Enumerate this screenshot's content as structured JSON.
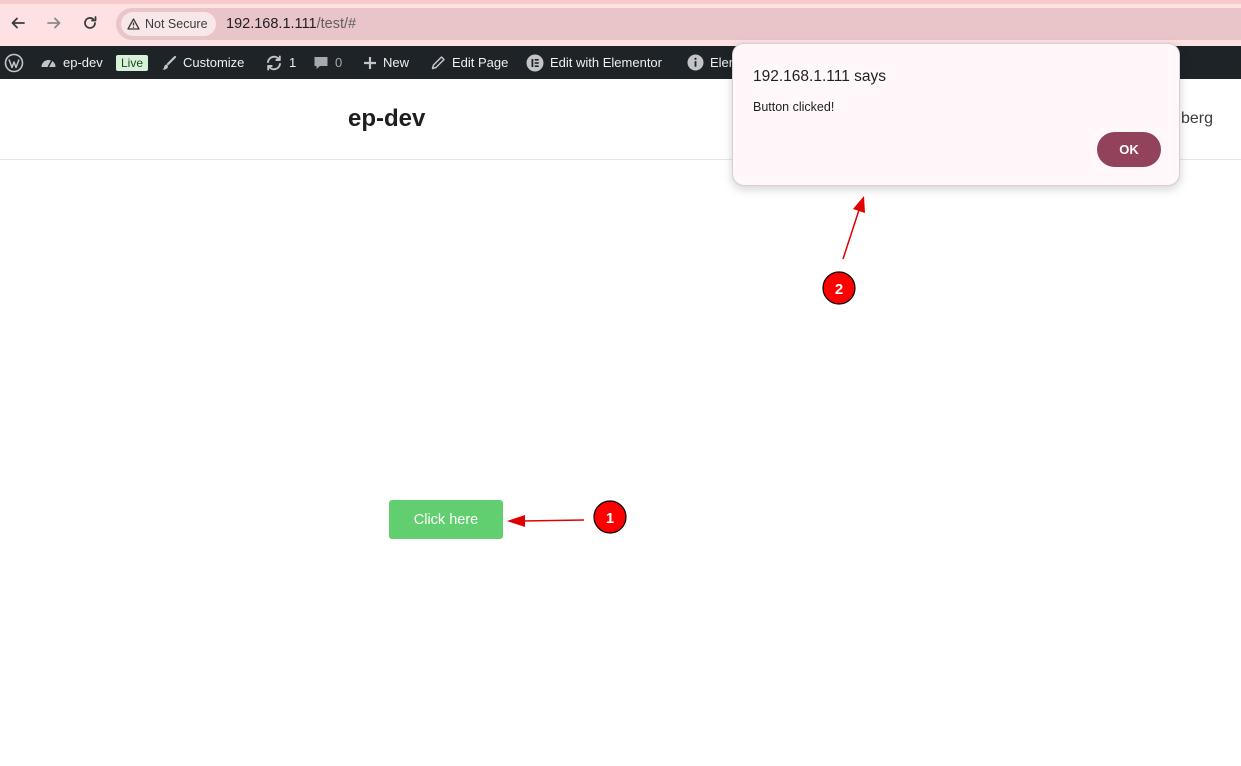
{
  "browser": {
    "security_label": "Not Secure",
    "url_host": "192.168.1.111",
    "url_path": "/test/#"
  },
  "adminbar": {
    "site_name": "ep-dev",
    "live_badge": "Live",
    "customize": "Customize",
    "updates_count": "1",
    "comments_count": "0",
    "new_label": "New",
    "edit_page": "Edit Page",
    "edit_elementor": "Edit with Elementor",
    "elementor_partial": "Elem"
  },
  "site": {
    "title": "ep-dev",
    "nav_partial": "berg"
  },
  "page": {
    "button_label": "Click here",
    "button_color": "#61ce70"
  },
  "dialog": {
    "title": "192.168.1.111 says",
    "message": "Button clicked!",
    "ok_label": "OK",
    "ok_color": "#92425a"
  },
  "annotations": {
    "marker_1": "1",
    "marker_2": "2",
    "arrow_color": "#e00000"
  }
}
